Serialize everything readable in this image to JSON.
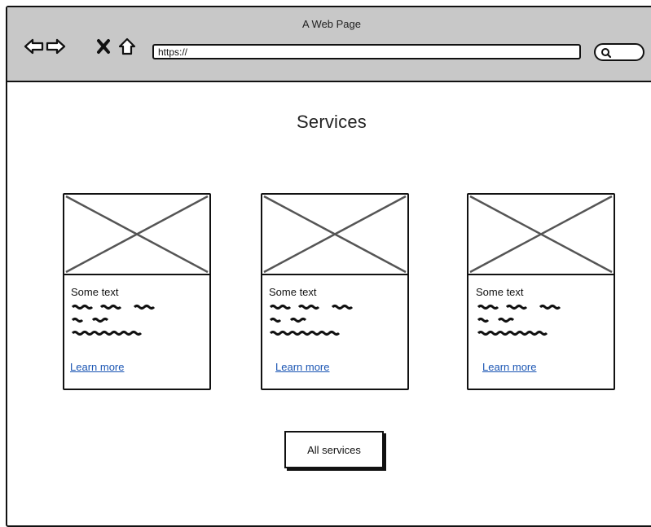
{
  "window": {
    "title": "A Web Page"
  },
  "toolbar": {
    "icons": [
      "back-arrow-icon",
      "forward-arrow-icon",
      "close-icon",
      "home-icon"
    ],
    "url": "https://",
    "search_icon": "search-icon"
  },
  "page": {
    "heading": "Services",
    "cards": [
      {
        "title": "Some text",
        "link": "Learn more"
      },
      {
        "title": "Some text",
        "link": "Learn more"
      },
      {
        "title": "Some text",
        "link": "Learn more"
      }
    ],
    "all_services_label": "All services"
  }
}
